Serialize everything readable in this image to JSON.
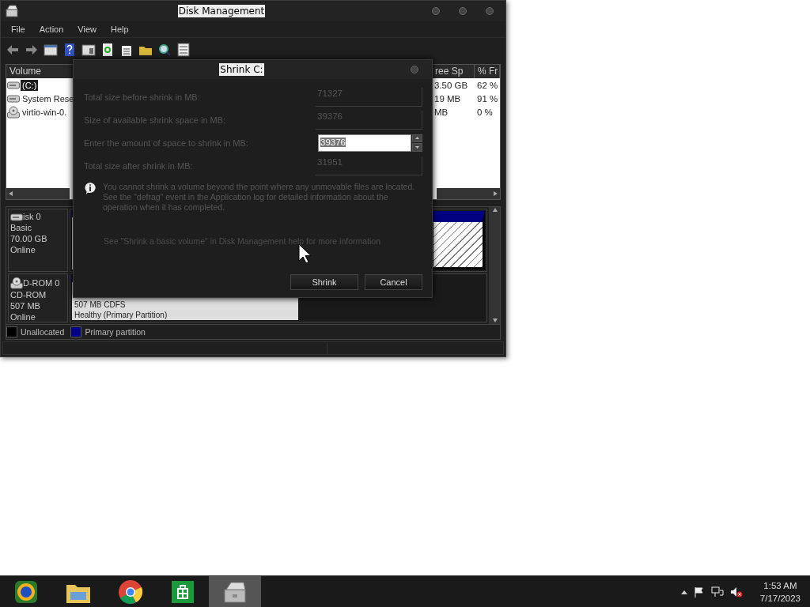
{
  "window": {
    "title": "Disk Management"
  },
  "menu": [
    "File",
    "Action",
    "View",
    "Help"
  ],
  "toolbar": [
    {
      "kind": "back"
    },
    {
      "kind": "forward"
    },
    {
      "kind": "console"
    },
    {
      "kind": "help"
    },
    {
      "kind": "panel"
    },
    {
      "kind": "refresh"
    },
    {
      "kind": "properties"
    },
    {
      "kind": "folder"
    },
    {
      "kind": "magnifier"
    },
    {
      "kind": "checklist"
    }
  ],
  "volume_list": {
    "columns": [
      "Volume",
      "ree Sp",
      "% Fr"
    ],
    "rows": [
      {
        "kind": "disk",
        "volume": "(C:)",
        "free": "3.50 GB",
        "percent": "62 %",
        "selected": true
      },
      {
        "kind": "disk",
        "volume": "System Rese",
        "free": "19 MB",
        "percent": "91 %",
        "selected": false
      },
      {
        "kind": "cd",
        "volume": "virtio-win-0.",
        "free": "MB",
        "percent": "0 %",
        "selected": false
      }
    ]
  },
  "disks": [
    {
      "kind": "disk",
      "name": "isk 0",
      "type": "Basic",
      "size": "70.00 GB",
      "status": "Online"
    },
    {
      "kind": "cd",
      "name": "D-ROM 0",
      "type": "CD-ROM",
      "size": "507 MB",
      "status": "Online"
    }
  ],
  "cd_partition": {
    "size": "507 MB CDFS",
    "status": "Healthy (Primary Partition)"
  },
  "legend": [
    {
      "label": "Unallocated",
      "color": "#000000"
    },
    {
      "label": "Primary partition",
      "color": "#000080"
    }
  ],
  "dialog": {
    "title": "Shrink C:",
    "fields": [
      {
        "kind": "readonly",
        "label": "Total size before shrink in MB:",
        "value": "71327"
      },
      {
        "kind": "readonly",
        "label": "Size of available shrink space in MB:",
        "value": "39376"
      },
      {
        "kind": "spin",
        "label": "Enter the amount of space to shrink in MB:",
        "value": "39376"
      },
      {
        "kind": "readonly",
        "label": "Total size after shrink in MB:",
        "value": "31951"
      }
    ],
    "info": "You cannot shrink a volume beyond the point where any unmovable files are located. See the \"defrag\" event in the Application log for detailed information about the operation when it has completed.",
    "help": "See \"Shrink a basic volume\" in Disk Management help for more information",
    "buttons": [
      "Shrink",
      "Cancel"
    ]
  },
  "taskbar": {
    "apps": [
      {
        "kind": "globe",
        "selected": false
      },
      {
        "kind": "folder",
        "selected": false
      },
      {
        "kind": "browser",
        "selected": false
      },
      {
        "kind": "store",
        "selected": false
      },
      {
        "kind": "toolbox",
        "selected": true
      }
    ],
    "time": "1:53 AM",
    "date": "7/17/2023"
  }
}
